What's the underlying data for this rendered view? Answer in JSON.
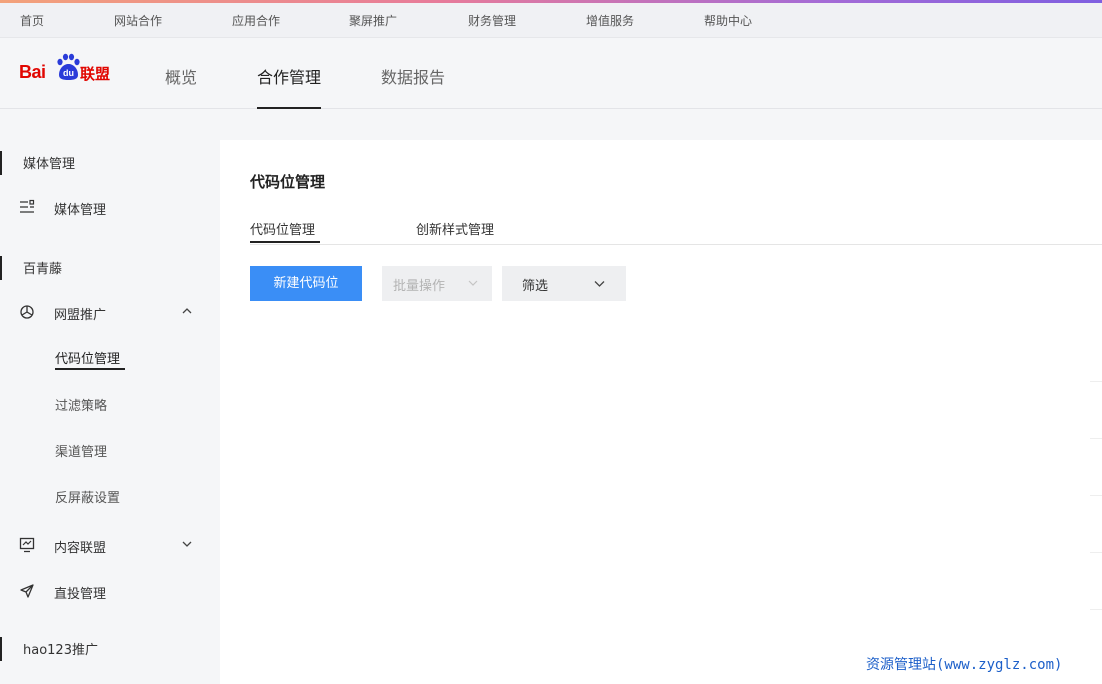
{
  "top_nav": [
    "首页",
    "网站合作",
    "应用合作",
    "聚屏推广",
    "财务管理",
    "增值服务",
    "帮助中心"
  ],
  "logo": {
    "bai": "Bai",
    "du": "du",
    "lianmeng": "联盟"
  },
  "main_tabs": [
    {
      "label": "概览",
      "active": false
    },
    {
      "label": "合作管理",
      "active": true
    },
    {
      "label": "数据报告",
      "active": false
    }
  ],
  "sidebar": {
    "sections": [
      "媒体管理",
      "百青藤",
      "hao123推广"
    ],
    "media_item": "媒体管理",
    "wangmeng": "网盟推广",
    "sub_items": [
      "代码位管理",
      "过滤策略",
      "渠道管理",
      "反屏蔽设置"
    ],
    "content_union": "内容联盟",
    "direct_mgmt": "直投管理"
  },
  "page": {
    "title": "代码位管理",
    "tabs": [
      "代码位管理",
      "创新样式管理"
    ],
    "new_button": "新建代码位",
    "batch_button": "批量操作",
    "filter_button": "筛选"
  },
  "watermark": "资源管理站(www.zyglz.com)",
  "colors": {
    "primary": "#3a8ef6",
    "brand": "#e10601",
    "watermark": "#1c5fc9"
  }
}
